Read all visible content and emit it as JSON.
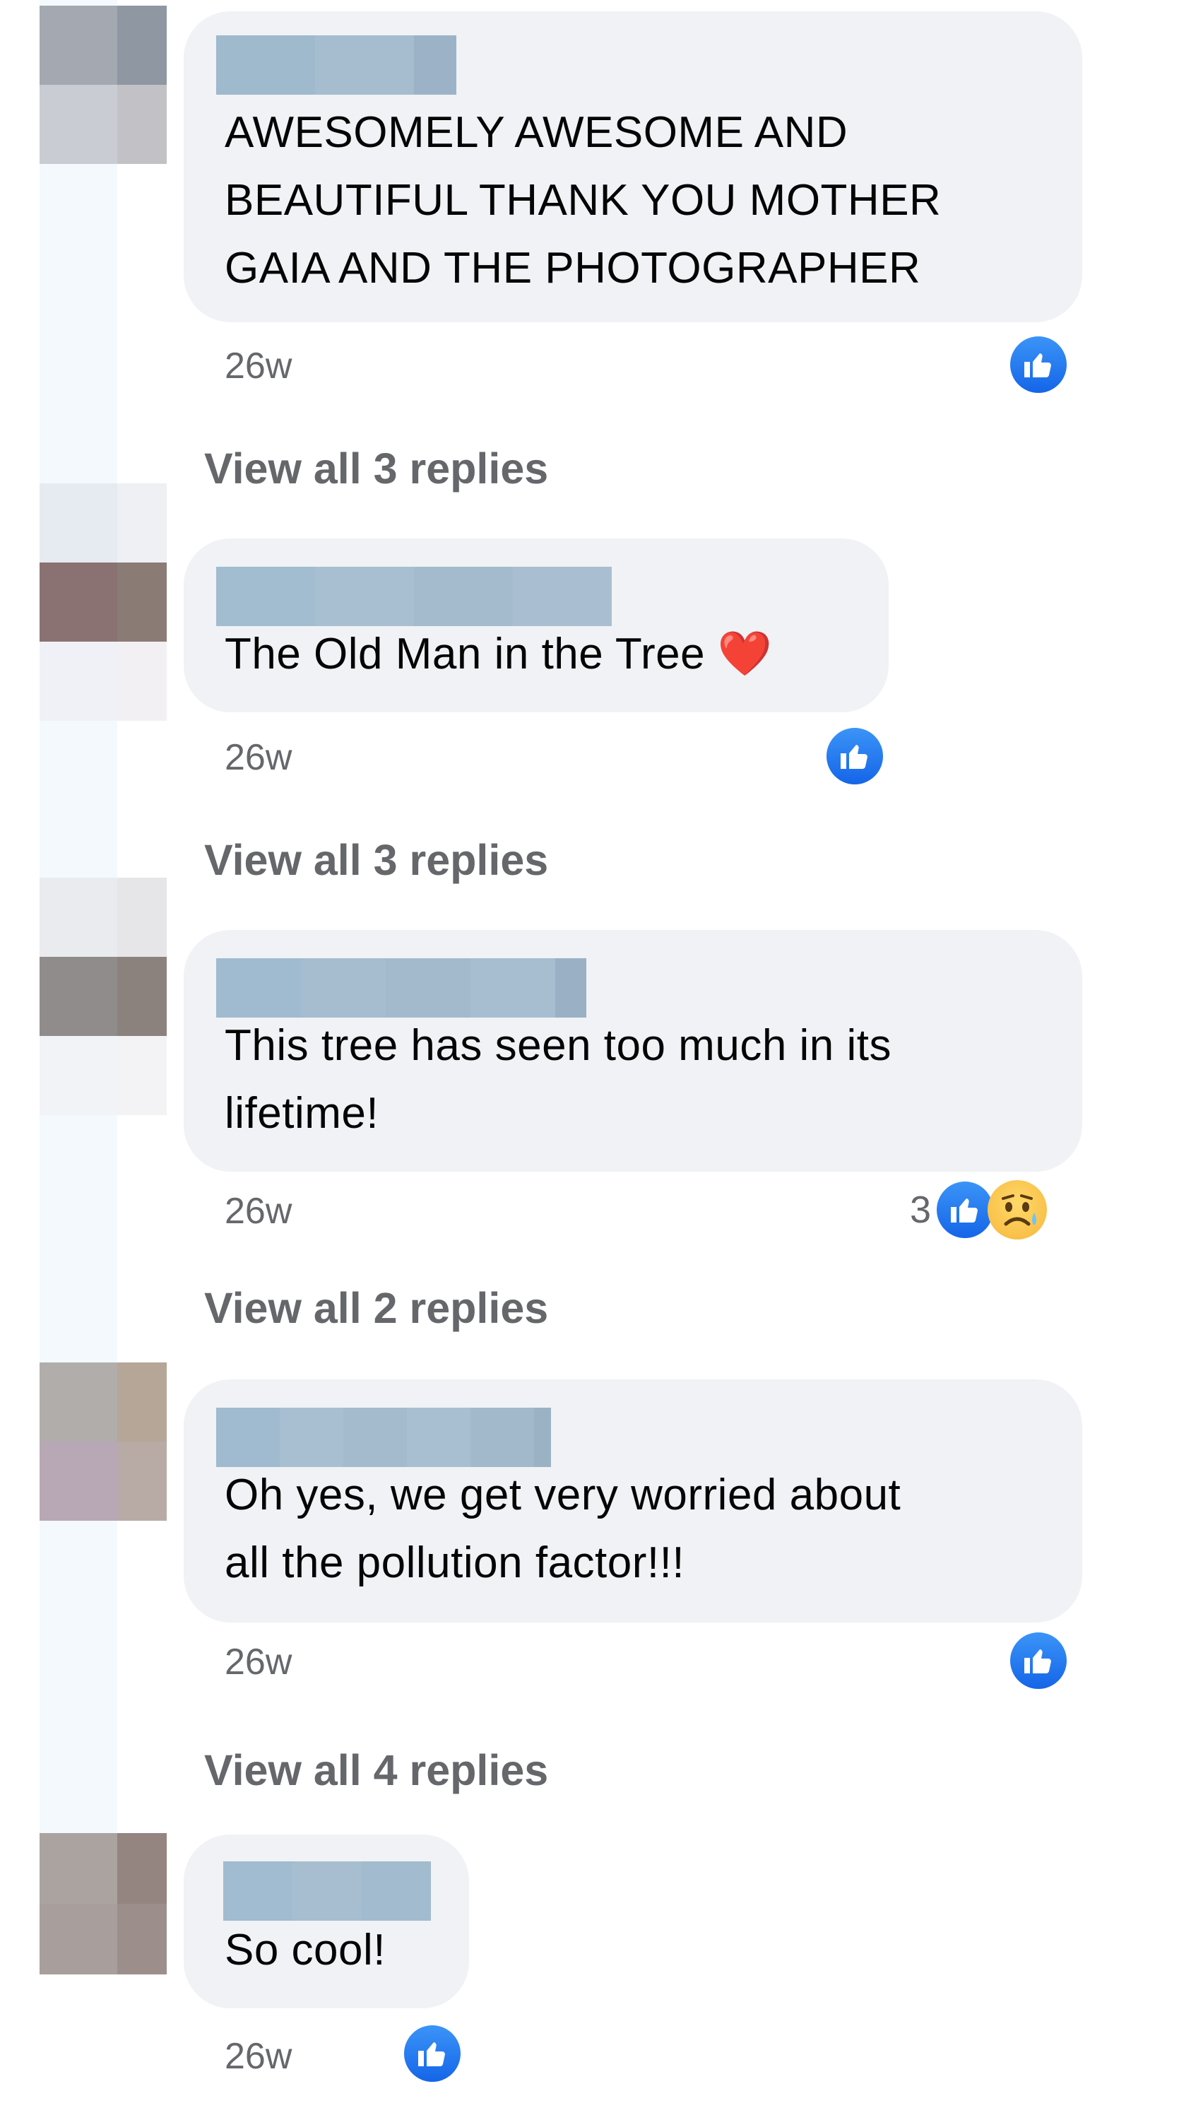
{
  "comments": [
    {
      "text_lines": [
        "AWESOMELY AWESOME AND",
        "BEAUTIFUL THANK YOU MOTHER",
        "GAIA AND THE PHOTOGRAPHER"
      ],
      "time": "26w",
      "reaction_count": "",
      "reactions": [
        "like-icon"
      ],
      "replies_label": "View all 3 replies"
    },
    {
      "text": "The Old Man in the Tree",
      "emoji": "❤️",
      "time": "26w",
      "reaction_count": "",
      "reactions": [
        "like-icon"
      ],
      "replies_label": "View all 3 replies"
    },
    {
      "text_lines": [
        "This tree has seen too much in its",
        "lifetime!"
      ],
      "time": "26w",
      "reaction_count": "3",
      "reactions": [
        "like-icon",
        "sad-icon"
      ],
      "replies_label": "View all 2 replies"
    },
    {
      "text_lines": [
        "Oh yes, we get very worried about",
        "all the pollution factor!!!"
      ],
      "time": "26w",
      "reaction_count": "",
      "reactions": [
        "like-icon"
      ],
      "replies_label": "View all 4 replies"
    },
    {
      "text": "So cool!",
      "time": "26w",
      "reaction_count": "",
      "reactions": [
        "like-icon"
      ]
    }
  ],
  "colors": {
    "bubble": "#f0f2f5",
    "like": "#1877f2",
    "secondary_text": "#65676b",
    "name_mask": "#9db7cc"
  }
}
